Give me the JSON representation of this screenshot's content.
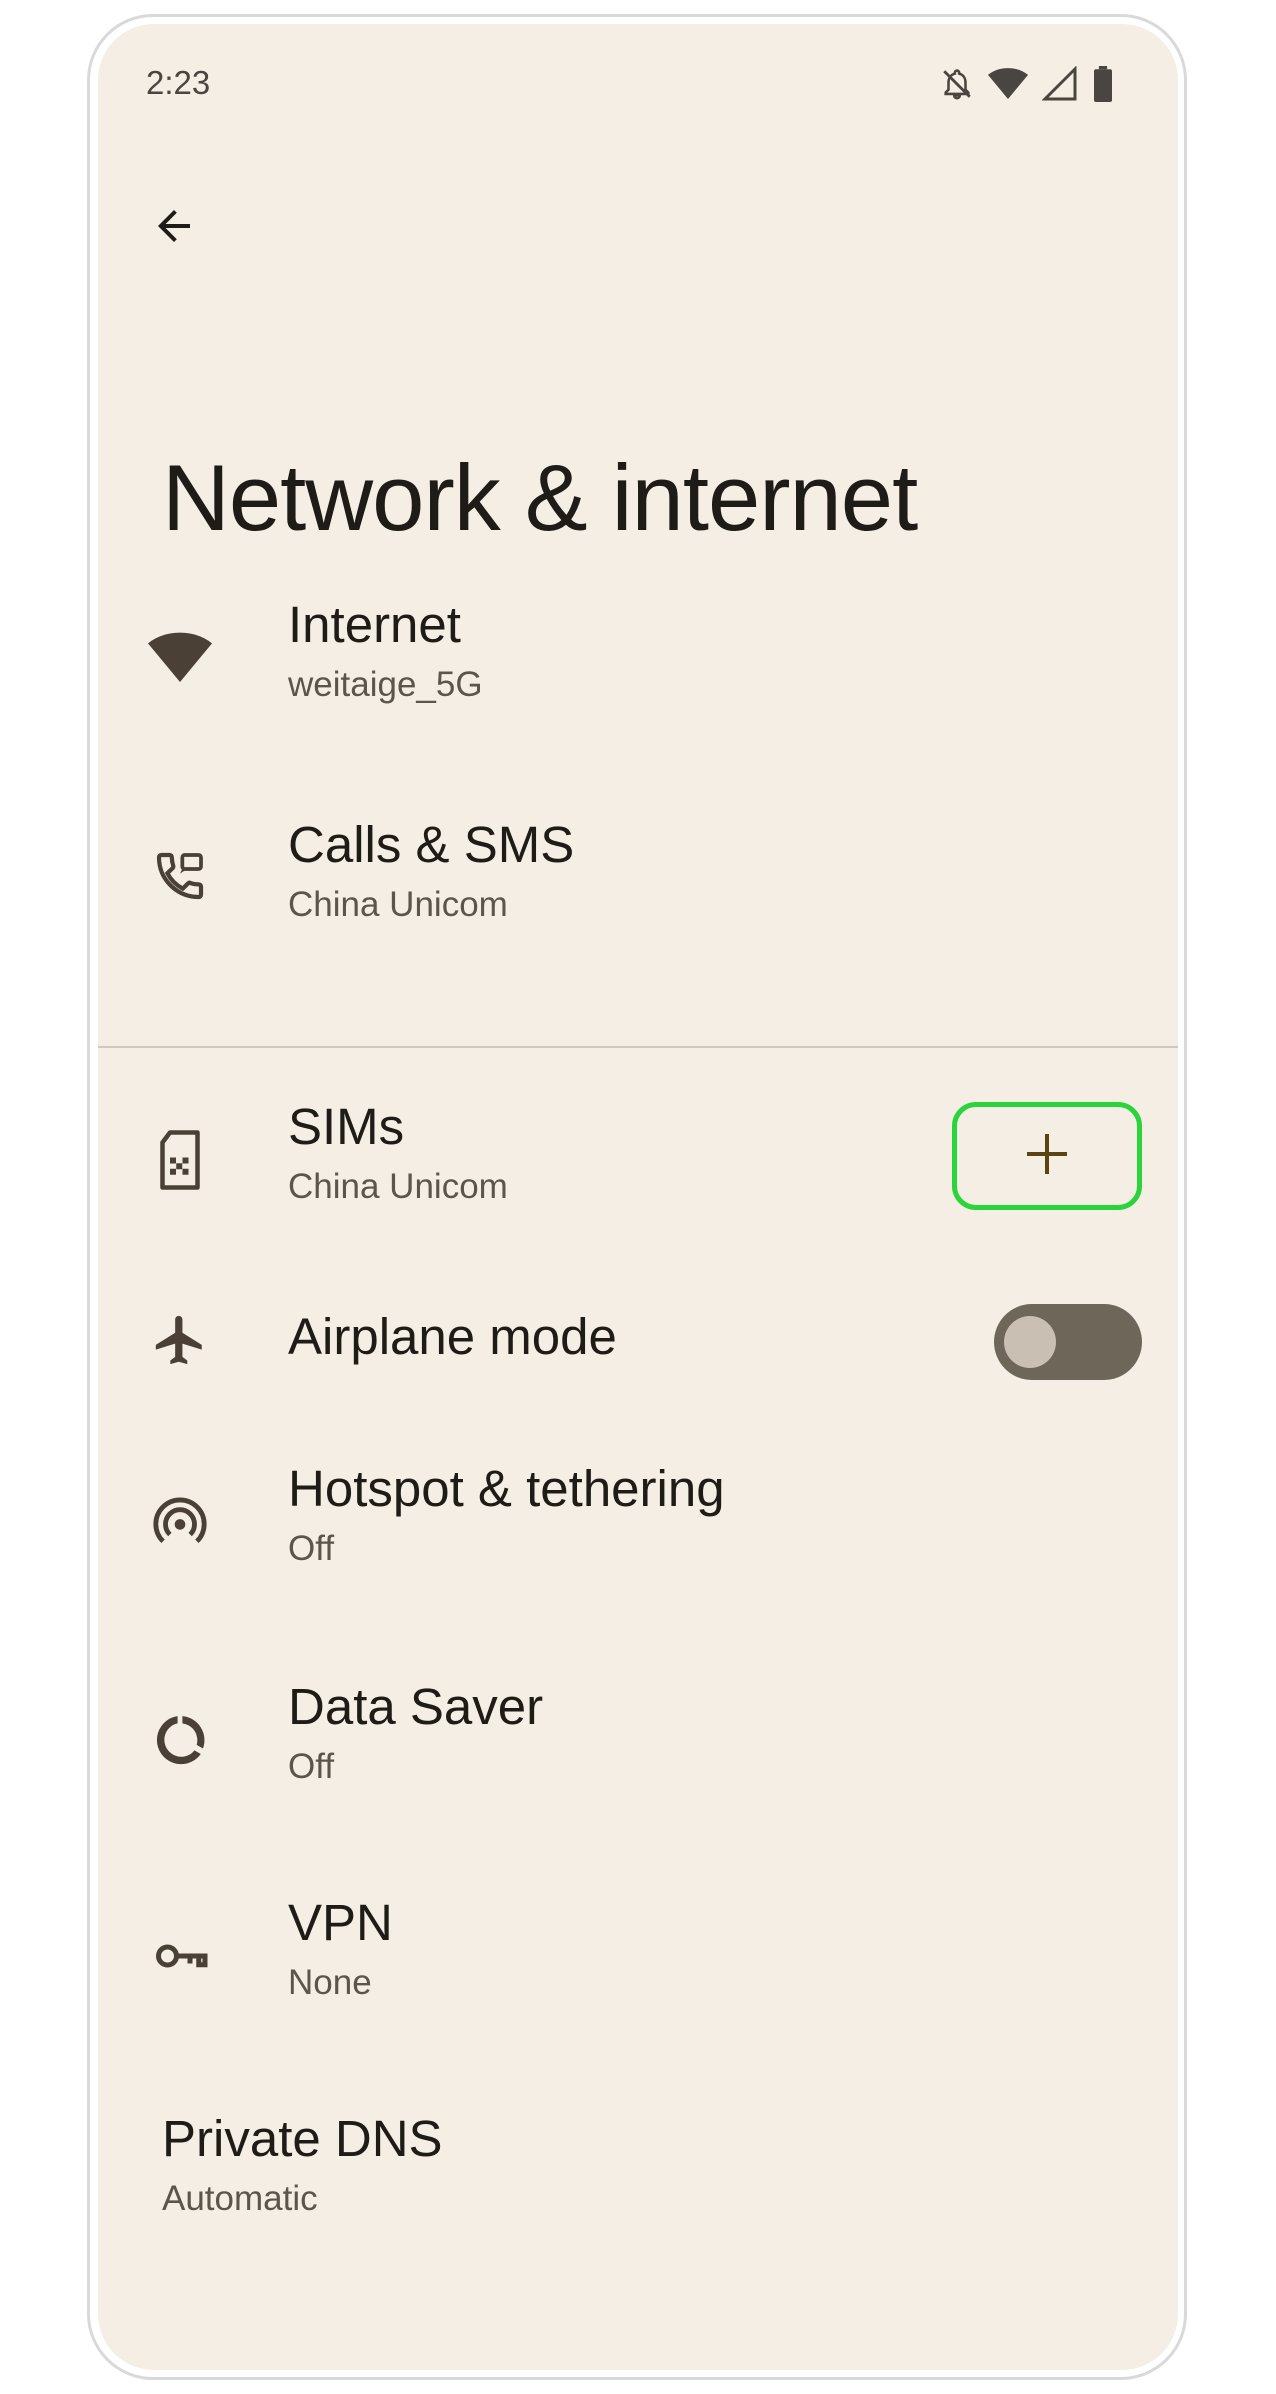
{
  "status_bar": {
    "time": "2:23",
    "icons": [
      "notifications-off-icon",
      "wifi-icon",
      "cellular-signal-icon",
      "battery-icon"
    ]
  },
  "header": {
    "back_icon": "arrow-back-icon",
    "title": "Network & internet"
  },
  "settings": {
    "internet": {
      "title": "Internet",
      "summary": "weitaige_5G",
      "icon": "wifi-icon"
    },
    "calls_sms": {
      "title": "Calls & SMS",
      "summary": "China Unicom",
      "icon": "calls-sms-icon"
    },
    "sims": {
      "title": "SIMs",
      "summary": "China Unicom",
      "icon": "sim-card-icon",
      "action_icon": "plus-icon"
    },
    "airplane": {
      "title": "Airplane mode",
      "icon": "airplane-icon",
      "toggle_on": false
    },
    "hotspot": {
      "title": "Hotspot & tethering",
      "summary": "Off",
      "icon": "hotspot-icon"
    },
    "data_saver": {
      "title": "Data Saver",
      "summary": "Off",
      "icon": "data-saver-icon"
    },
    "vpn": {
      "title": "VPN",
      "summary": "None",
      "icon": "vpn-key-icon"
    },
    "private_dns": {
      "title": "Private DNS",
      "summary": "Automatic"
    }
  },
  "colors": {
    "background": "#f4eee5",
    "text_primary": "#1f1b16",
    "text_secondary": "#5b554d",
    "highlight": "#2cd43c",
    "toggle_track": "#6e6659"
  }
}
